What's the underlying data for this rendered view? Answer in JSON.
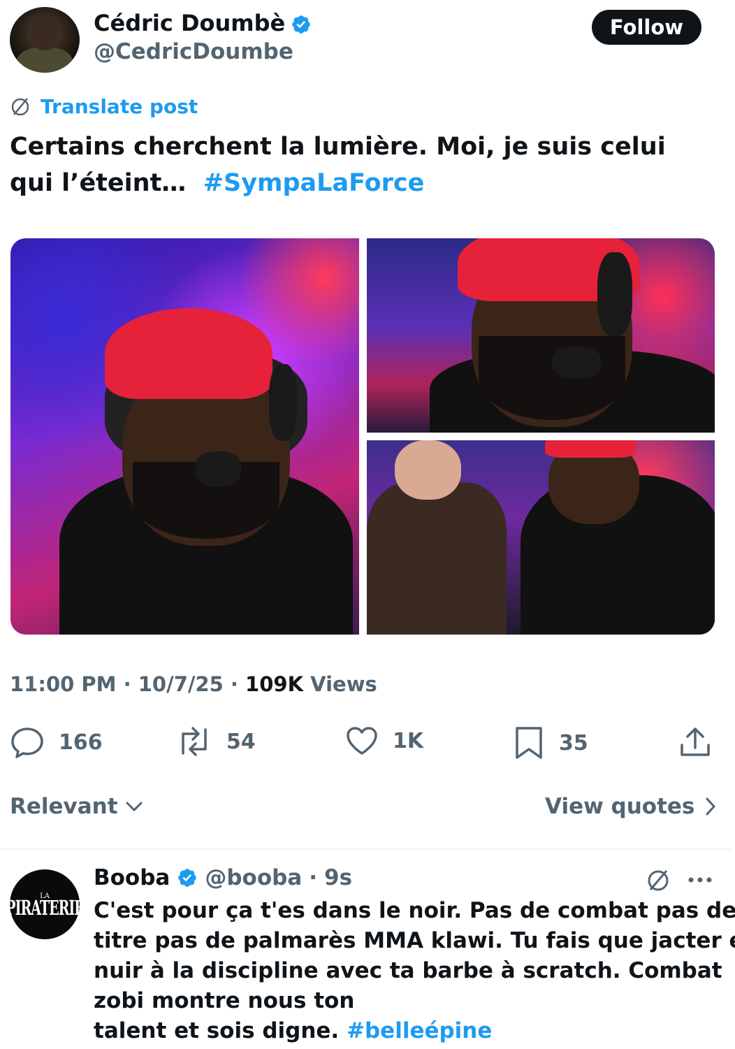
{
  "author": {
    "name": "Cédric Doumbè",
    "handle": "@CedricDoumbe",
    "follow_label": "Follow"
  },
  "post": {
    "translate_label": "Translate post",
    "text": "Certains cherchent la lumière. Moi, je suis celui qui l’éteint…",
    "hashtag": "#SympaLaForce",
    "time": "11:00 PM",
    "date": "10/7/25",
    "views_count": "109K",
    "views_label": "Views"
  },
  "actions": {
    "replies": "166",
    "reposts": "54",
    "likes": "1K",
    "bookmarks": "35"
  },
  "replies_bar": {
    "sort_label": "Relevant",
    "view_quotes_label": "View quotes"
  },
  "reply": {
    "name": "Booba",
    "handle": "@booba",
    "time": "9s",
    "avatar_small": "LA",
    "avatar_big": "PIRATERIE",
    "lines": [
      "C'est pour ça t'es dans le noir. Pas de combat pas de",
      "titre pas de palmarès MMA klawi. Tu fais que jacter et",
      "nuir à la discipline avec ta barbe à scratch. Combat",
      "zobi montre nous ton",
      "talent et sois digne."
    ],
    "hashtag": "#belleépine"
  },
  "colors": {
    "accent": "#1d9bf0",
    "text": "#0f1419",
    "secondary": "#536471"
  }
}
